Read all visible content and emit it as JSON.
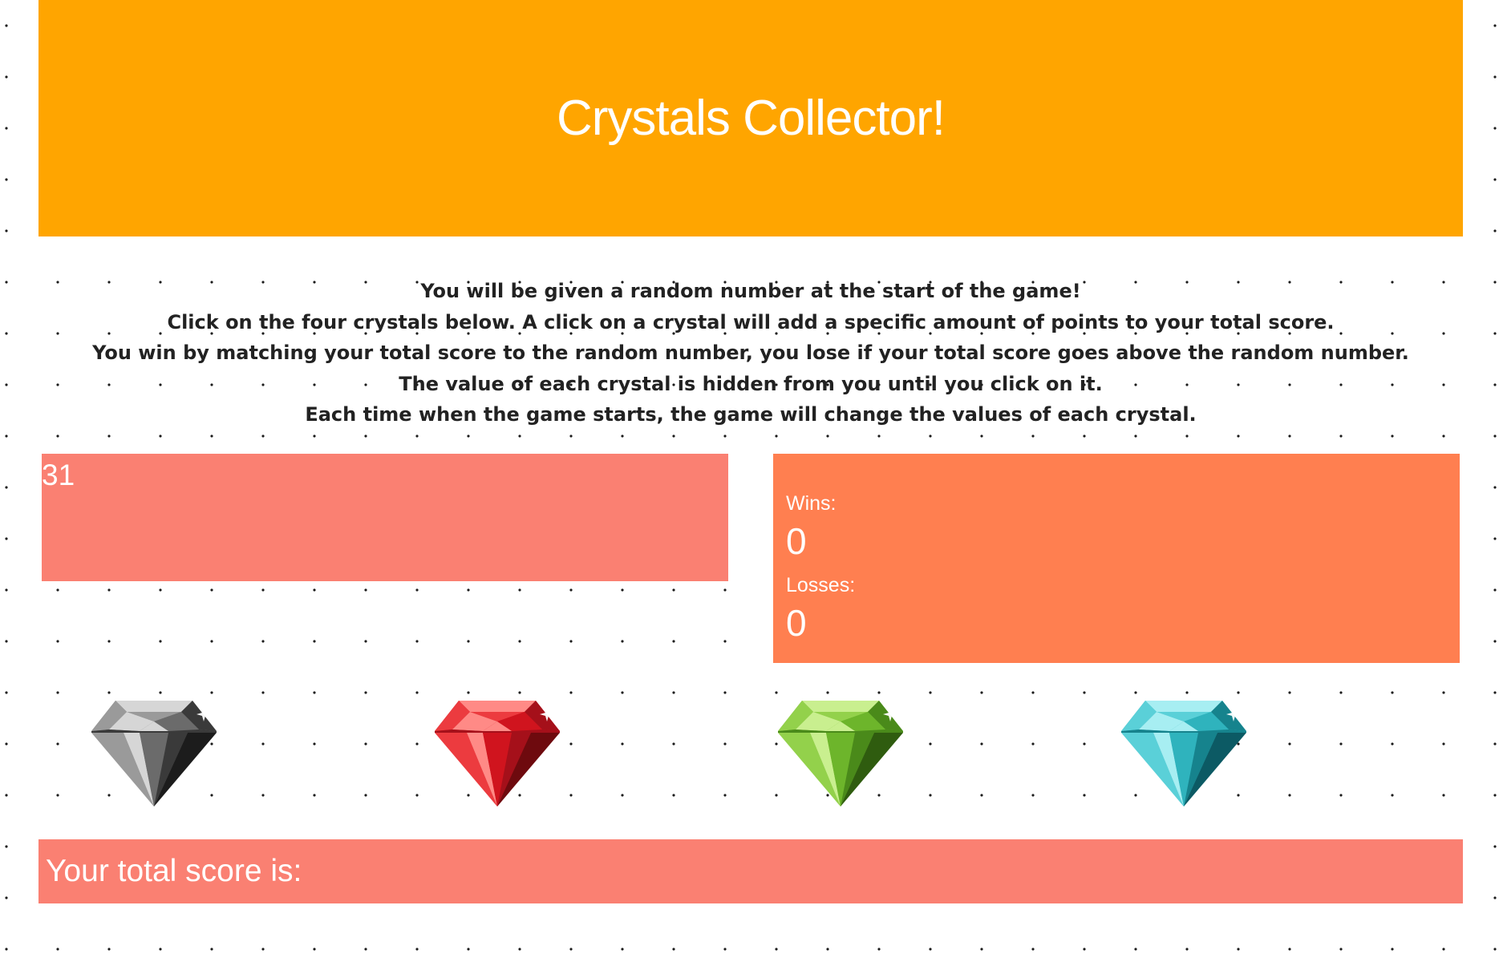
{
  "header": {
    "title": "Crystals Collector!"
  },
  "instructions": [
    "You will be given a random number at the start of the game!",
    "Click on the four crystals below. A click on a crystal will add a specific amount of points to your total score.",
    "You win by matching your total score to the random number, you lose if your total score goes above the random number.",
    "The value of each crystal is hidden from you until you click on it.",
    "Each time when the game starts, the game will change the values of each crystal."
  ],
  "target": {
    "number": "31"
  },
  "stats": {
    "wins_label": "Wins:",
    "wins_value": "0",
    "losses_label": "Losses:",
    "losses_value": "0"
  },
  "crystals": [
    {
      "icon": "gray-crystal-icon",
      "color": "#5a5a5a"
    },
    {
      "icon": "red-crystal-icon",
      "color": "#d0141e"
    },
    {
      "icon": "green-crystal-icon",
      "color": "#6db52b"
    },
    {
      "icon": "blue-crystal-icon",
      "color": "#2fb3bd"
    }
  ],
  "score": {
    "label": "Your total score is:",
    "value": ""
  },
  "colors": {
    "header_bg": "#ffa500",
    "target_bg": "#fa8072",
    "stats_bg": "#ff7f50",
    "score_bg": "#fa8072"
  }
}
